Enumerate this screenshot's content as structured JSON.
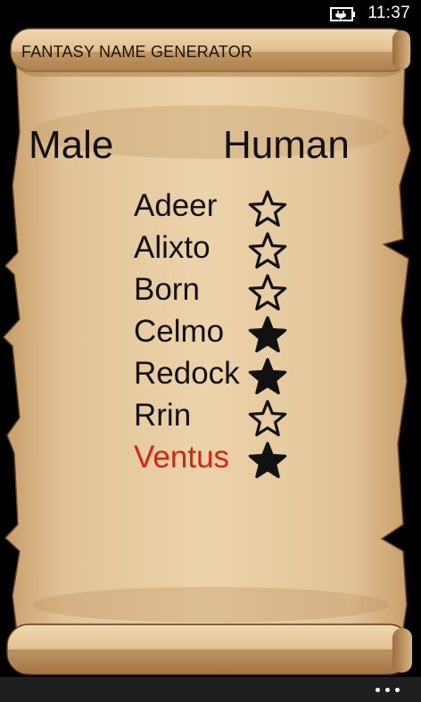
{
  "status_bar": {
    "time": "11:37",
    "icons": [
      "battery-charging-icon"
    ]
  },
  "app": {
    "title": "FANTASY NAME GENERATOR"
  },
  "selection": {
    "gender": "Male",
    "race": "Human"
  },
  "names": [
    {
      "name": "Adeer",
      "favorite": false,
      "highlighted": false
    },
    {
      "name": "Alixto",
      "favorite": false,
      "highlighted": false
    },
    {
      "name": "Born",
      "favorite": false,
      "highlighted": false
    },
    {
      "name": "Celmo",
      "favorite": true,
      "highlighted": false
    },
    {
      "name": "Redock",
      "favorite": true,
      "highlighted": false
    },
    {
      "name": "Rrin",
      "favorite": false,
      "highlighted": false
    },
    {
      "name": "Ventus",
      "favorite": true,
      "highlighted": true
    }
  ],
  "colors": {
    "parchment": "#e6c89c",
    "parchment_shadow": "#c9a270",
    "highlight": "#d9250f",
    "app_bar": "#1f1f1f"
  },
  "app_bar": {
    "icons": [
      "more-options-icon"
    ]
  }
}
